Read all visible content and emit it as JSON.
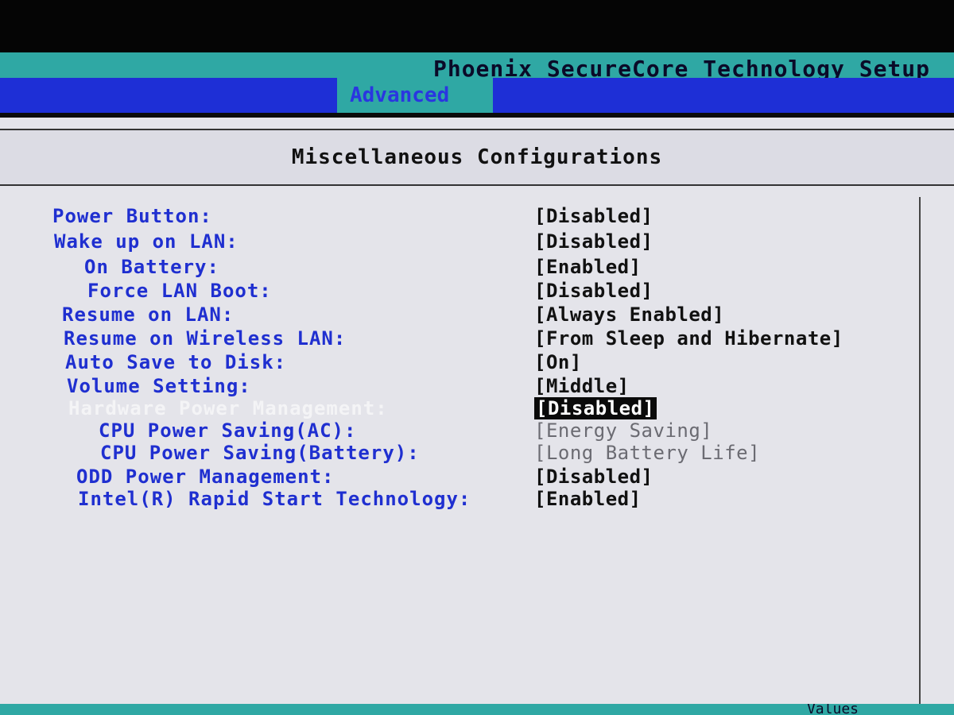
{
  "window": {
    "title": "Phoenix SecureCore Technology Setup",
    "active_tab": "Advanced"
  },
  "page": {
    "heading": "Miscellaneous Configurations"
  },
  "settings": [
    {
      "label": "Power Button:",
      "value": "[Disabled]"
    },
    {
      "label": "Wake up on LAN:",
      "value": "[Disabled]"
    },
    {
      "label": "On Battery:",
      "value": "[Enabled]"
    },
    {
      "label": "Force LAN Boot:",
      "value": "[Disabled]"
    },
    {
      "label": "Resume on LAN:",
      "value": "[Always Enabled]"
    },
    {
      "label": "Resume on Wireless LAN:",
      "value": "[From Sleep and Hibernate]"
    },
    {
      "label": "Auto Save to Disk:",
      "value": "[On]"
    },
    {
      "label": "Volume Setting:",
      "value": "[Middle]"
    },
    {
      "label": "Hardware Power Management:",
      "value": "[Disabled]"
    },
    {
      "label": "CPU Power Saving(AC):",
      "value": "[Energy Saving]"
    },
    {
      "label": "CPU Power Saving(Battery):",
      "value": "[Long Battery Life]"
    },
    {
      "label": "ODD Power Management:",
      "value": "[Disabled]"
    },
    {
      "label": "Intel(R) Rapid Start Technology:",
      "value": "[Enabled]"
    }
  ],
  "status": {
    "partial_text": "Values"
  },
  "colors": {
    "cyan_bar": "#2fa8a4",
    "blue_bar": "#1e2fd6",
    "label_blue": "#1f2fd0",
    "panel_bg": "#e4e4ea"
  }
}
